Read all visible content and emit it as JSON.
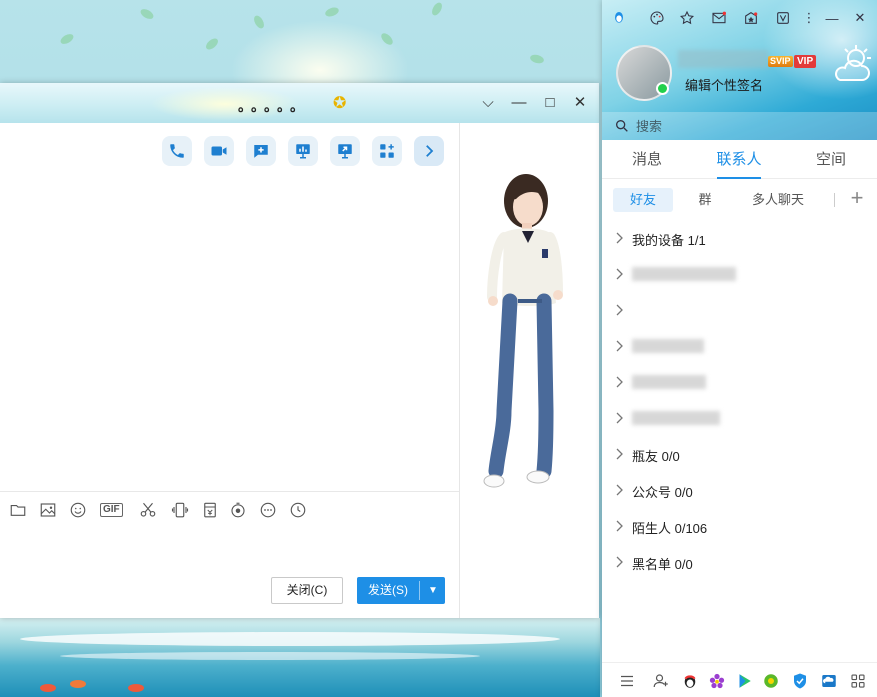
{
  "chat_window": {
    "title": "。。。。。",
    "controls": {
      "collapse": "⌵",
      "minimize": "—",
      "maximize": "□",
      "close": "✕"
    },
    "toolbar_top": [
      "phone-icon",
      "video-icon",
      "message-plus-icon",
      "present-icon",
      "screen-share-icon",
      "apps-icon",
      "chevron-right-icon"
    ],
    "toolbar_bottom": [
      "folder-icon",
      "image-icon",
      "emoji-icon",
      "gif-icon",
      "scissors-icon",
      "shake-icon",
      "red-packet-icon",
      "record-icon",
      "more-icon",
      "history-icon"
    ],
    "gif_label": "GIF",
    "close_button": "关闭(C)",
    "send_button": "发送(S)"
  },
  "panel": {
    "signature": "编辑个性签名",
    "badges": {
      "svip": "SVIP",
      "vip": "VIP"
    },
    "search_placeholder": "搜索",
    "tabs": [
      {
        "label": "消息"
      },
      {
        "label": "联系人"
      },
      {
        "label": "空间"
      }
    ],
    "active_tab": "联系人",
    "sub_tabs": [
      {
        "label": "好友"
      },
      {
        "label": "群"
      },
      {
        "label": "多人聊天"
      }
    ],
    "groups": [
      {
        "label": "我的设备 1/1"
      },
      {
        "label": ""
      },
      {
        "label": ""
      },
      {
        "label": ""
      },
      {
        "label": ""
      },
      {
        "label": ""
      },
      {
        "label": "瓶友 0/0"
      },
      {
        "label": "公众号 0/0"
      },
      {
        "label": "陌生人 0/106"
      },
      {
        "label": "黑名单 0/0"
      }
    ]
  },
  "colors": {
    "accent": "#1e8fe6",
    "send_button": "#1e8fe6",
    "online": "#22d04c"
  }
}
